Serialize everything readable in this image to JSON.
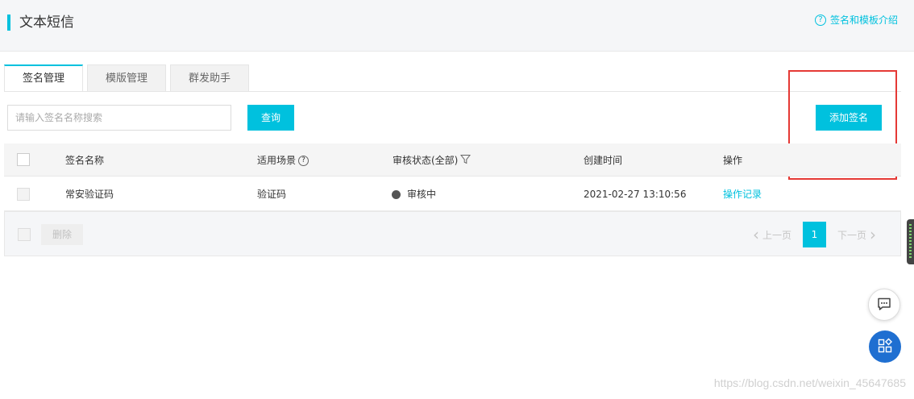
{
  "header": {
    "title": "文本短信",
    "help_link": "签名和模板介绍",
    "help_icon_char": "?"
  },
  "tabs": [
    {
      "label": "签名管理",
      "active": true
    },
    {
      "label": "模版管理",
      "active": false
    },
    {
      "label": "群发助手",
      "active": false
    }
  ],
  "search": {
    "placeholder": "请输入签名名称搜索",
    "value": "",
    "button_label": "查询"
  },
  "actions": {
    "add_label": "添加签名"
  },
  "table": {
    "columns": {
      "name": "签名名称",
      "scene": "适用场景",
      "scene_tip_char": "?",
      "status": "审核状态(全部)",
      "created": "创建时间",
      "ops": "操作"
    },
    "rows": [
      {
        "name": "常安验证码",
        "scene": "验证码",
        "status": "审核中",
        "created": "2021-02-27 13:10:56",
        "op": "操作记录"
      }
    ]
  },
  "footer": {
    "delete_label": "删除",
    "prev_label": "上一页",
    "next_label": "下一页",
    "current_page": "1"
  },
  "watermark": "https://blog.csdn.net/weixin_45647685",
  "colors": {
    "accent": "#00c1de",
    "highlight": "#e53935",
    "fab_blue": "#1f6fd1"
  }
}
